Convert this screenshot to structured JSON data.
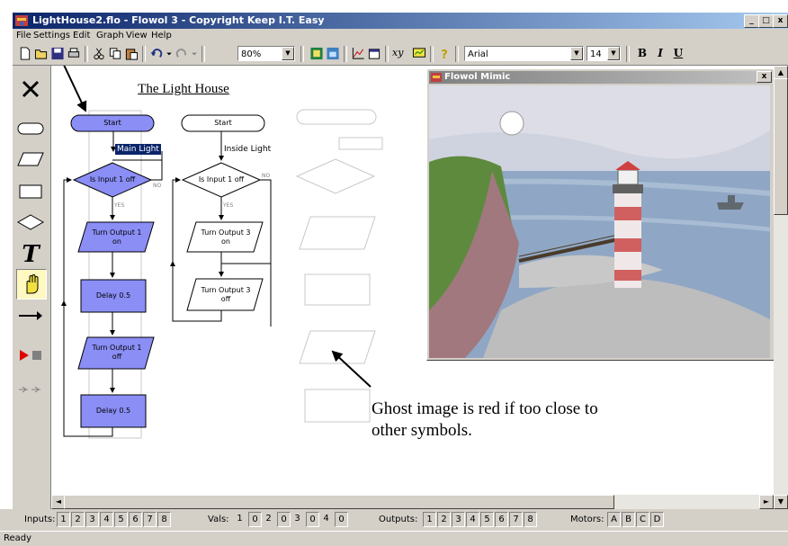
{
  "app": {
    "title": "LightHouse2.flo - Flowol 3 - Copyright Keep I.T. Easy",
    "window_buttons": [
      "_",
      "□",
      "x"
    ]
  },
  "menu": [
    "File",
    "Settings",
    "Edit",
    "Graph",
    "View",
    "Help"
  ],
  "toolbar": {
    "zoom": "80%",
    "xy_label": "xy",
    "font": "Arial",
    "font_size": "14",
    "bold": "B",
    "italic": "I",
    "underline": "U"
  },
  "palette": [
    {
      "icon": "delete-icon"
    },
    {
      "icon": "start-terminal-icon"
    },
    {
      "icon": "parallelogram-icon"
    },
    {
      "icon": "rectangle-icon"
    },
    {
      "icon": "diamond-icon"
    },
    {
      "icon": "text-icon",
      "label": "T"
    },
    {
      "icon": "hand-icon"
    },
    {
      "icon": "arrow-icon"
    },
    {
      "icon": "run-stop-icon"
    },
    {
      "icon": "step-icon"
    }
  ],
  "flowchart": {
    "heading": "The Light House",
    "col1": {
      "start": "Start",
      "sub_label": "Main Light",
      "decision": "Is Input 1 off",
      "no": "NO",
      "yes": "YES",
      "out1": "Turn Output 1 on",
      "delay1": "Delay 0.5",
      "out2": "Turn Output 1 off",
      "delay2": "Delay 0.5"
    },
    "col2": {
      "start": "Start",
      "sub_label": "Inside Light",
      "decision": "Is Input 1 off",
      "no": "NO",
      "yes": "YES",
      "out1": "Turn Output 3 on",
      "out2": "Turn Output 3 off"
    }
  },
  "annotation": "Ghost image is red if too close to other symbols.",
  "mimic": {
    "title": "Flowol Mimic",
    "close": "x"
  },
  "io": {
    "inputs_label": "Inputs:",
    "inputs": [
      "1",
      "2",
      "3",
      "4",
      "5",
      "6",
      "7",
      "8"
    ],
    "vals_label": "Vals:",
    "vals": [
      "1",
      "0",
      "2",
      "0",
      "3",
      "0",
      "4",
      "0"
    ],
    "outputs_label": "Outputs:",
    "outputs": [
      "1",
      "2",
      "3",
      "4",
      "5",
      "6",
      "7",
      "8"
    ],
    "motors_label": "Motors:",
    "motors": [
      "A",
      "B",
      "C",
      "D"
    ]
  },
  "status": "Ready",
  "colors": {
    "symbol_fill": "#8a8ef5",
    "title_blue": "#0a246a",
    "face": "#d4d0c8",
    "ghost": "#c8c8c8"
  }
}
